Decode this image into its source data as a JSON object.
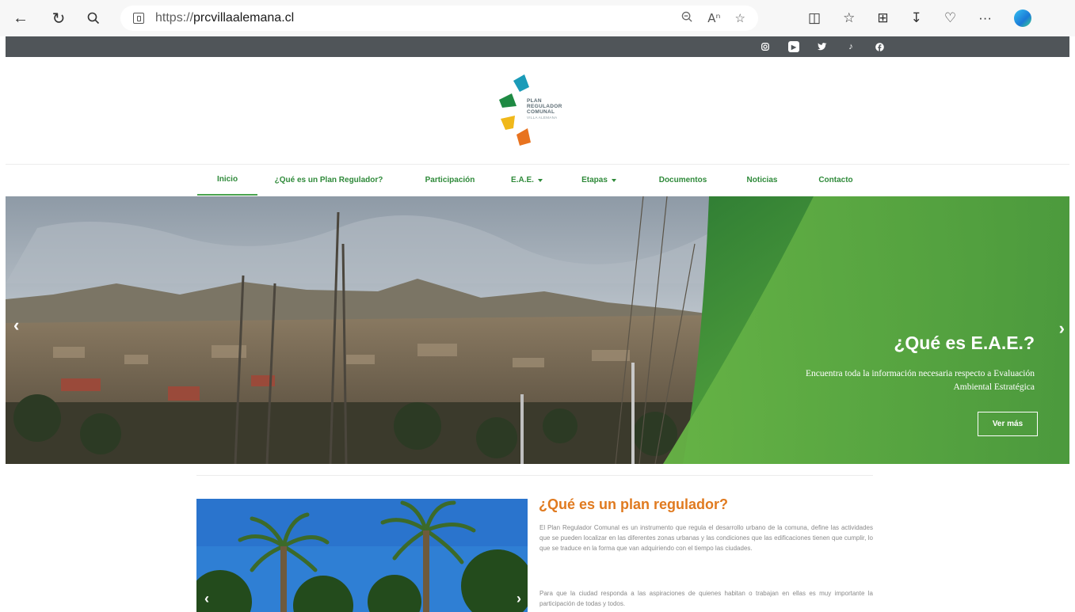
{
  "browser": {
    "url_prefix": "https://",
    "url_host": "prcvillaalemana.cl",
    "more_label": "···"
  },
  "social": [
    "instagram-icon",
    "youtube-icon",
    "twitter-icon",
    "tiktok-icon",
    "facebook-icon"
  ],
  "logo": {
    "line1": "PLAN",
    "line2": "REGULADOR",
    "line3": "COMUNAL",
    "line4": "VILLA ALEMANA",
    "colors": [
      "#1a9bb8",
      "#1e8a43",
      "#f0b81a",
      "#e8731f"
    ]
  },
  "nav": {
    "items": [
      {
        "label": "Inicio"
      },
      {
        "label": "¿Qué es un Plan Regulador?"
      },
      {
        "label": "Participación"
      },
      {
        "label": "E.A.E."
      },
      {
        "label": "Etapas"
      },
      {
        "label": "Documentos"
      },
      {
        "label": "Noticias"
      },
      {
        "label": "Contacto"
      }
    ],
    "active_color": "#4aa34f"
  },
  "hero": {
    "title": "¿Qué es E.A.E.?",
    "text": "Encuentra toda la información necesaria respecto a Evaluación Ambiental Estratégica",
    "button": "Ver más",
    "prev": "‹",
    "next": "›",
    "accent": "#4f9e3c"
  },
  "content": {
    "title": "¿Qué es un plan regulador?",
    "p1": "El Plan Regulador Comunal es un instrumento que regula el desarrollo urbano de la comuna, define las actividades que se pueden localizar en las diferentes zonas urbanas y las condiciones que las edificaciones tienen que cumplir, lo que se traduce en la forma que van adquiriendo con el tiempo las ciudades.",
    "p2": "Para que la ciudad responda a las aspiraciones de quienes habitan o trabajan en ellas es muy importante la participación de todas y todos.",
    "prev": "‹",
    "next": "›"
  }
}
